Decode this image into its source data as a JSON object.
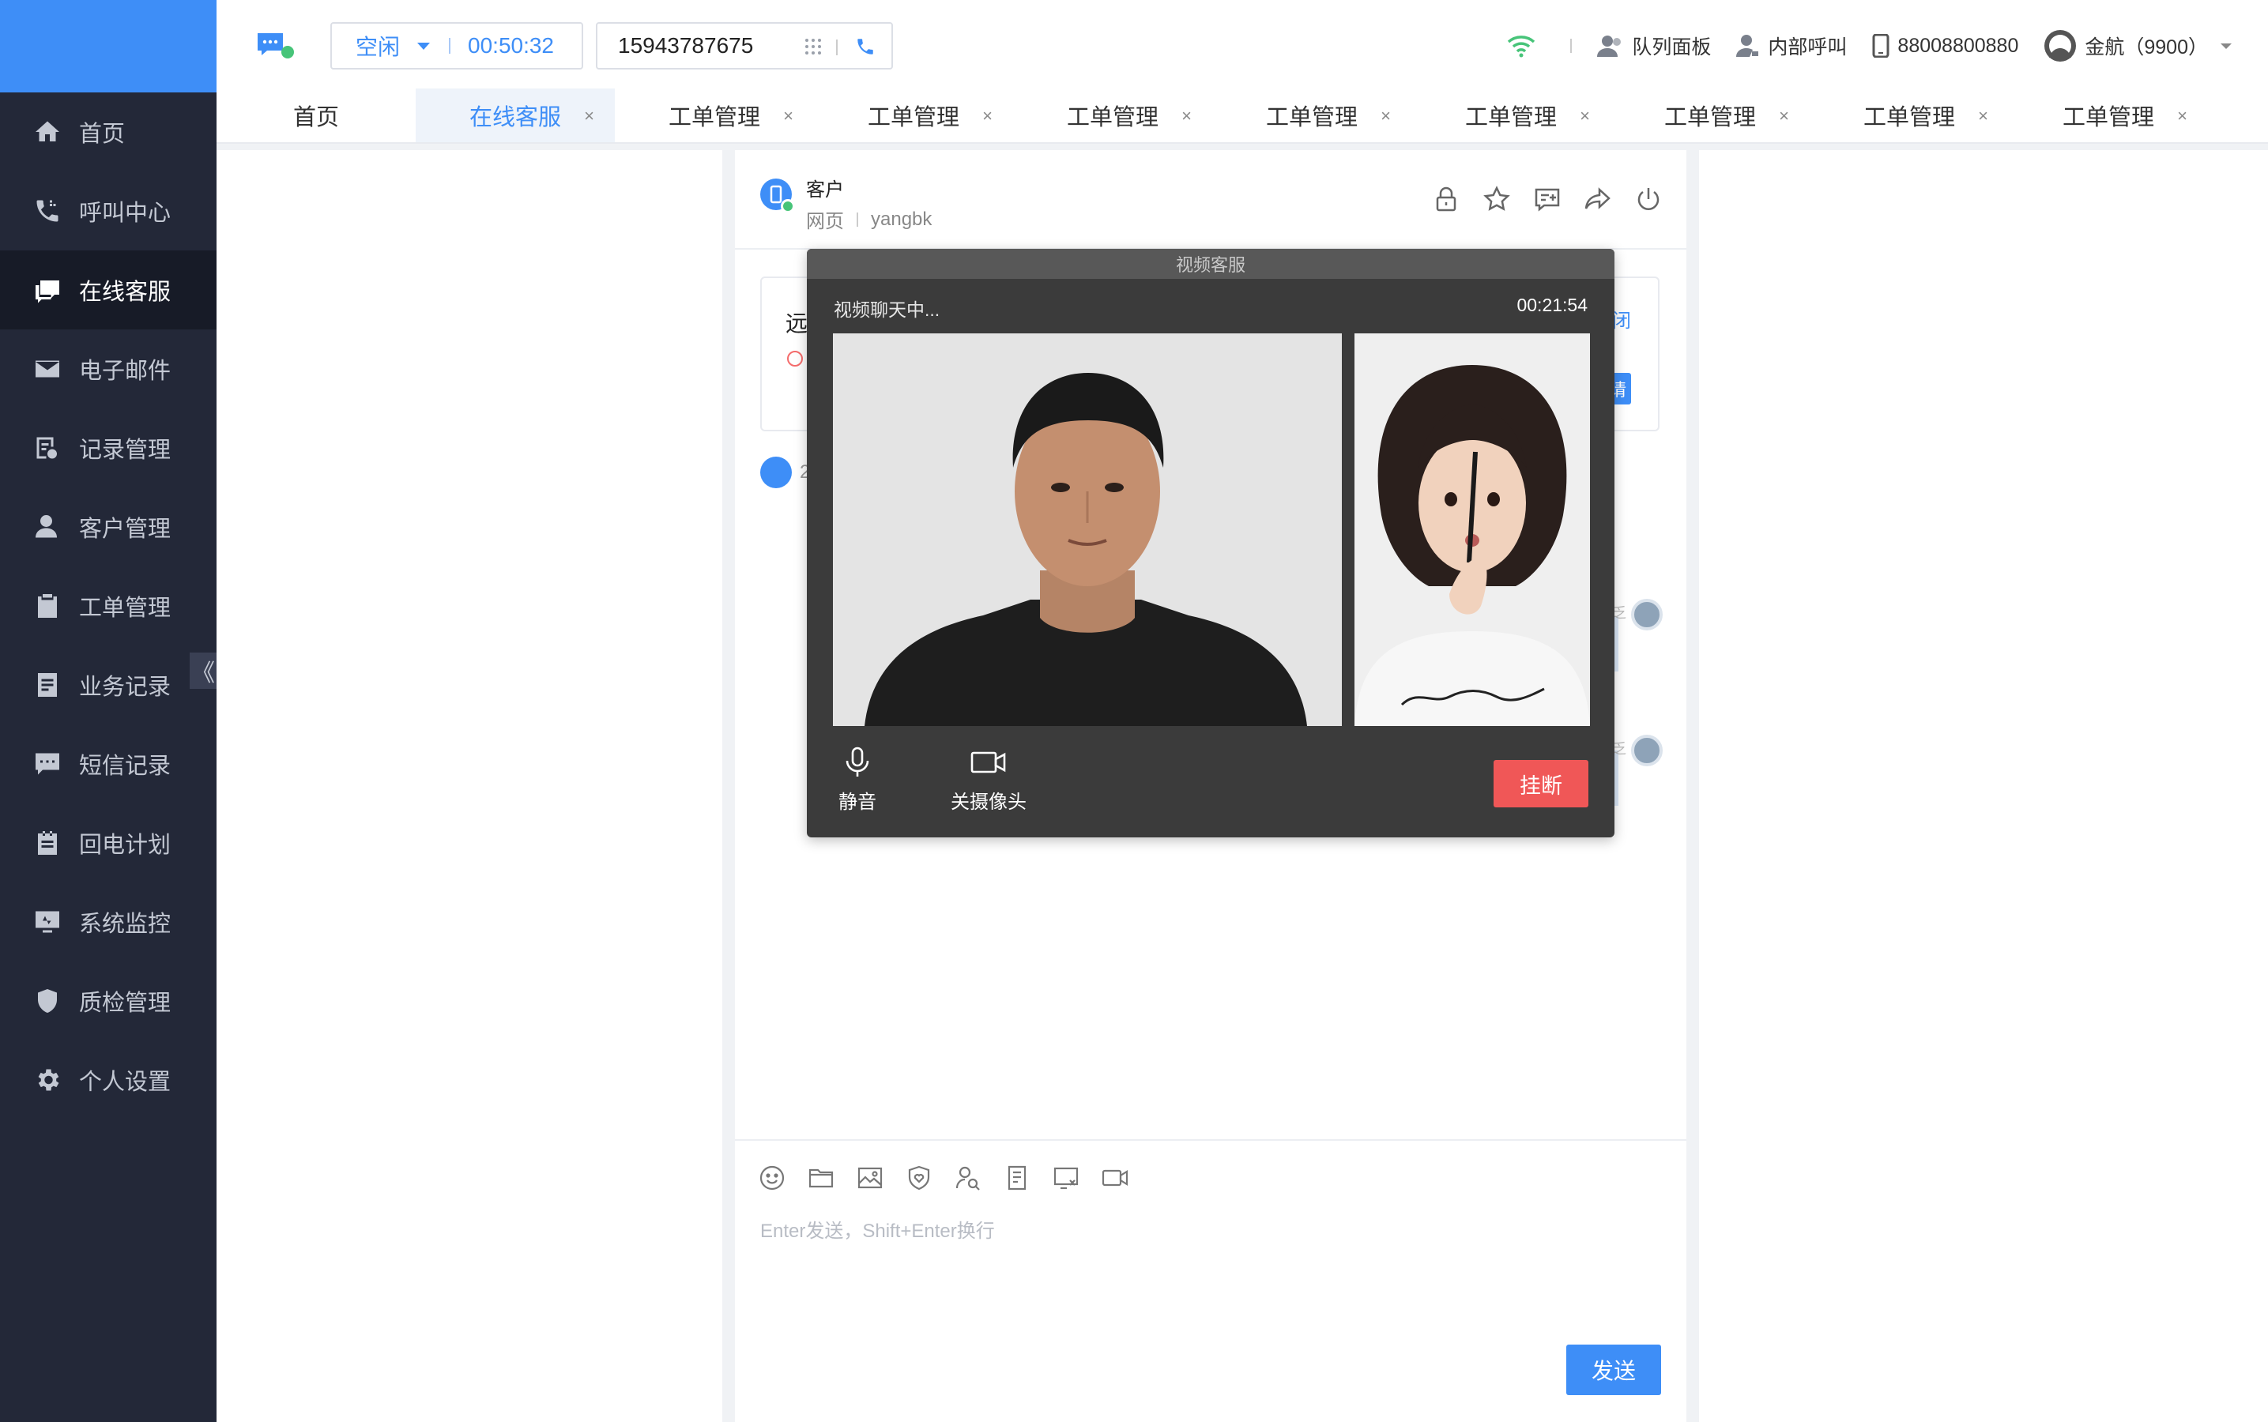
{
  "sidebar": {
    "items": [
      {
        "label": "首页",
        "icon": "home-icon"
      },
      {
        "label": "呼叫中心",
        "icon": "phone-call-icon"
      },
      {
        "label": "在线客服",
        "icon": "chat-icon",
        "active": true
      },
      {
        "label": "电子邮件",
        "icon": "mail-icon"
      },
      {
        "label": "记录管理",
        "icon": "record-icon"
      },
      {
        "label": "客户管理",
        "icon": "customer-icon"
      },
      {
        "label": "工单管理",
        "icon": "clipboard-icon"
      },
      {
        "label": "业务记录",
        "icon": "document-icon"
      },
      {
        "label": "短信记录",
        "icon": "sms-icon"
      },
      {
        "label": "回电计划",
        "icon": "calendar-icon"
      },
      {
        "label": "系统监控",
        "icon": "monitor-icon"
      },
      {
        "label": "质检管理",
        "icon": "shield-icon"
      },
      {
        "label": "个人设置",
        "icon": "gear-icon"
      }
    ],
    "collapse_glyph": "《"
  },
  "topbar": {
    "status_label": "空闲",
    "timer": "00:50:32",
    "phone_number": "15943787675",
    "queue_panel": "队列面板",
    "internal_call": "内部呼叫",
    "extension_number": "88008800880",
    "user": "金航（9900）"
  },
  "tabs": [
    {
      "label": "首页",
      "closable": false
    },
    {
      "label": "在线客服",
      "closable": true,
      "active": true
    },
    {
      "label": "工单管理",
      "closable": true
    },
    {
      "label": "工单管理",
      "closable": true
    },
    {
      "label": "工单管理",
      "closable": true
    },
    {
      "label": "工单管理",
      "closable": true
    },
    {
      "label": "工单管理",
      "closable": true
    },
    {
      "label": "工单管理",
      "closable": true
    },
    {
      "label": "工单管理",
      "closable": true
    },
    {
      "label": "工单管理",
      "closable": true
    }
  ],
  "tab_close_glyph": "×",
  "chat": {
    "customer_name": "客户",
    "channel": "网页",
    "customer_id": "yangbk",
    "notice_title_partial": "远",
    "notice_close_partial": "闭",
    "notice_button_partial": "请",
    "msg_partial": "2",
    "agent_marker_partial": "乏"
  },
  "composer": {
    "hint": "Enter发送，Shift+Enter换行",
    "send_label": "发送",
    "tools": [
      "emoji-icon",
      "folder-icon",
      "image-icon",
      "shield-heart-icon",
      "user-search-icon",
      "note-icon",
      "screen-capture-icon",
      "video-icon"
    ]
  },
  "video": {
    "title": "视频客服",
    "status": "视频聊天中...",
    "timer": "00:21:54",
    "mute_label": "静音",
    "camera_off_label": "关摄像头",
    "hangup_label": "挂断"
  },
  "colors": {
    "brand": "#3e8ef7",
    "sidebar_bg": "#232838",
    "hangup": "#f05757",
    "wifi": "#47c479"
  }
}
